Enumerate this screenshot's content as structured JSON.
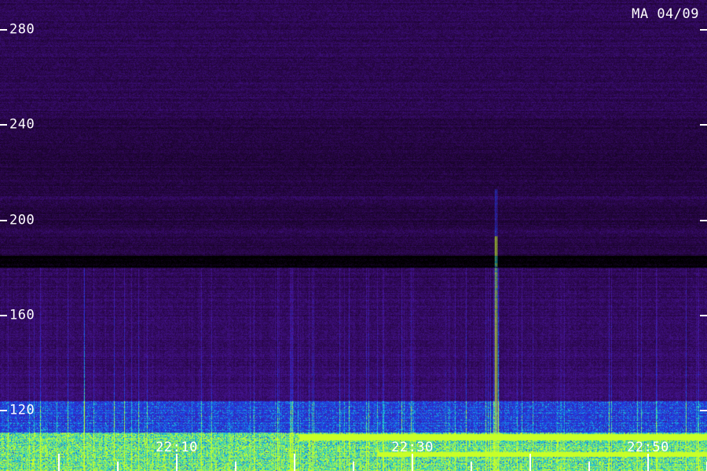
{
  "stamp": "MA 04/09",
  "y_axis": {
    "ticks": [
      {
        "value": 120,
        "label": "120"
      },
      {
        "value": 160,
        "label": "160"
      },
      {
        "value": 200,
        "label": "200"
      },
      {
        "value": 240,
        "label": "240"
      },
      {
        "value": 280,
        "label": "280"
      }
    ]
  },
  "x_axis": {
    "labels": [
      {
        "minute": 10,
        "label": "22:10"
      },
      {
        "minute": 30,
        "label": "22:30"
      },
      {
        "minute": 50,
        "label": "22:50"
      }
    ],
    "tick_minutes": [
      0,
      5,
      10,
      15,
      20,
      25,
      30,
      35,
      40,
      45,
      50,
      55
    ]
  },
  "colors": {
    "background": "#000000",
    "low": "#3a0a5c",
    "mid": "#2030d0",
    "high": "#20e0c0",
    "peak": "#c8ff20",
    "labels": "#ffffff"
  }
}
